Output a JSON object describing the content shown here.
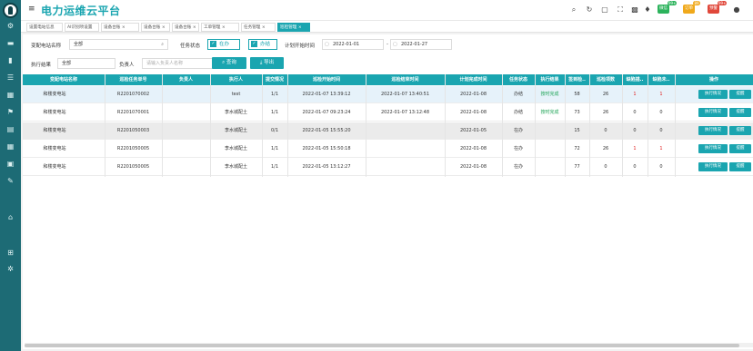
{
  "app": {
    "title": "电力运维云平台"
  },
  "header": {
    "badges": [
      {
        "label": "微信",
        "num": "99+",
        "color": "#2cb35c"
      },
      {
        "label": "订单",
        "num": "89",
        "color": "#f0a91b"
      },
      {
        "label": "预警",
        "num": "99+",
        "color": "#e0473a"
      }
    ]
  },
  "tabs": [
    {
      "label": "设置电站信息"
    },
    {
      "label": "AI识别项设置"
    },
    {
      "label": "设备台账 ×"
    },
    {
      "label": "设备台账 ×"
    },
    {
      "label": "设备台账 ×"
    },
    {
      "label": "工单管理 ×"
    },
    {
      "label": "任务管理 ×"
    },
    {
      "label": "巡检管理 ×"
    }
  ],
  "filters": {
    "station_label": "变配电站名称",
    "station_value": "全部",
    "status_label": "任务状态",
    "status_opt1": "在办",
    "status_opt2": "办结",
    "plan_time_label": "计划开始时间",
    "date_from": "2022-01-01",
    "date_to": "2022-01-27",
    "exec_label": "执行结果",
    "exec_value": "全部",
    "person_label": "负责人",
    "person_placeholder": "请输入负责人名称",
    "query_button": "查询",
    "export_button": "导出"
  },
  "table": {
    "headers": [
      "变配电站名称",
      "巡检任务单号",
      "负责人",
      "执行人",
      "提交情况",
      "巡检开始时间",
      "巡检结束时间",
      "计划完成时间",
      "任务状态",
      "执行结果",
      "签到检..",
      "巡检项数",
      "缺陷描..",
      "缺陷未..",
      "操作"
    ],
    "rows": [
      {
        "station": "和楼变电站",
        "order": "R2201070002",
        "lead": "",
        "exec": "test",
        "submit": "1/1",
        "start": "2022-01-07 13:39:12",
        "end": "2022-01-07 13:40:51",
        "plan": "2022-01-08",
        "status": "办结",
        "result": "按时完成",
        "sign": "58",
        "items": "26",
        "def1": "1",
        "def2": "1"
      },
      {
        "station": "和楼变电站",
        "order": "R2201070001",
        "lead": "",
        "exec": "李水城配土",
        "submit": "1/1",
        "start": "2022-01-07 09:23:24",
        "end": "2022-01-07 13:12:48",
        "plan": "2022-01-08",
        "status": "办结",
        "result": "按时完成",
        "sign": "73",
        "items": "26",
        "def1": "0",
        "def2": "0"
      },
      {
        "station": "和楼变电站",
        "order": "R2201050003",
        "lead": "",
        "exec": "李水城配土",
        "submit": "0/1",
        "start": "2022-01-05 15:55:20",
        "end": "",
        "plan": "2022-01-05",
        "status": "在办",
        "result": "",
        "sign": "15",
        "items": "0",
        "def1": "0",
        "def2": "0"
      },
      {
        "station": "和楼变电站",
        "order": "R2201050005",
        "lead": "",
        "exec": "李水城配土",
        "submit": "1/1",
        "start": "2022-01-05 15:50:18",
        "end": "",
        "plan": "2022-01-08",
        "status": "在办",
        "result": "",
        "sign": "72",
        "items": "26",
        "def1": "1",
        "def2": "1"
      },
      {
        "station": "和楼变电站",
        "order": "R2201050005",
        "lead": "",
        "exec": "李水城配土",
        "submit": "1/1",
        "start": "2022-01-05 13:12:27",
        "end": "",
        "plan": "2022-01-08",
        "status": "在办",
        "result": "",
        "sign": "77",
        "items": "0",
        "def1": "0",
        "def2": "0"
      }
    ],
    "action_labels": [
      "执行情况",
      "提醒"
    ]
  }
}
